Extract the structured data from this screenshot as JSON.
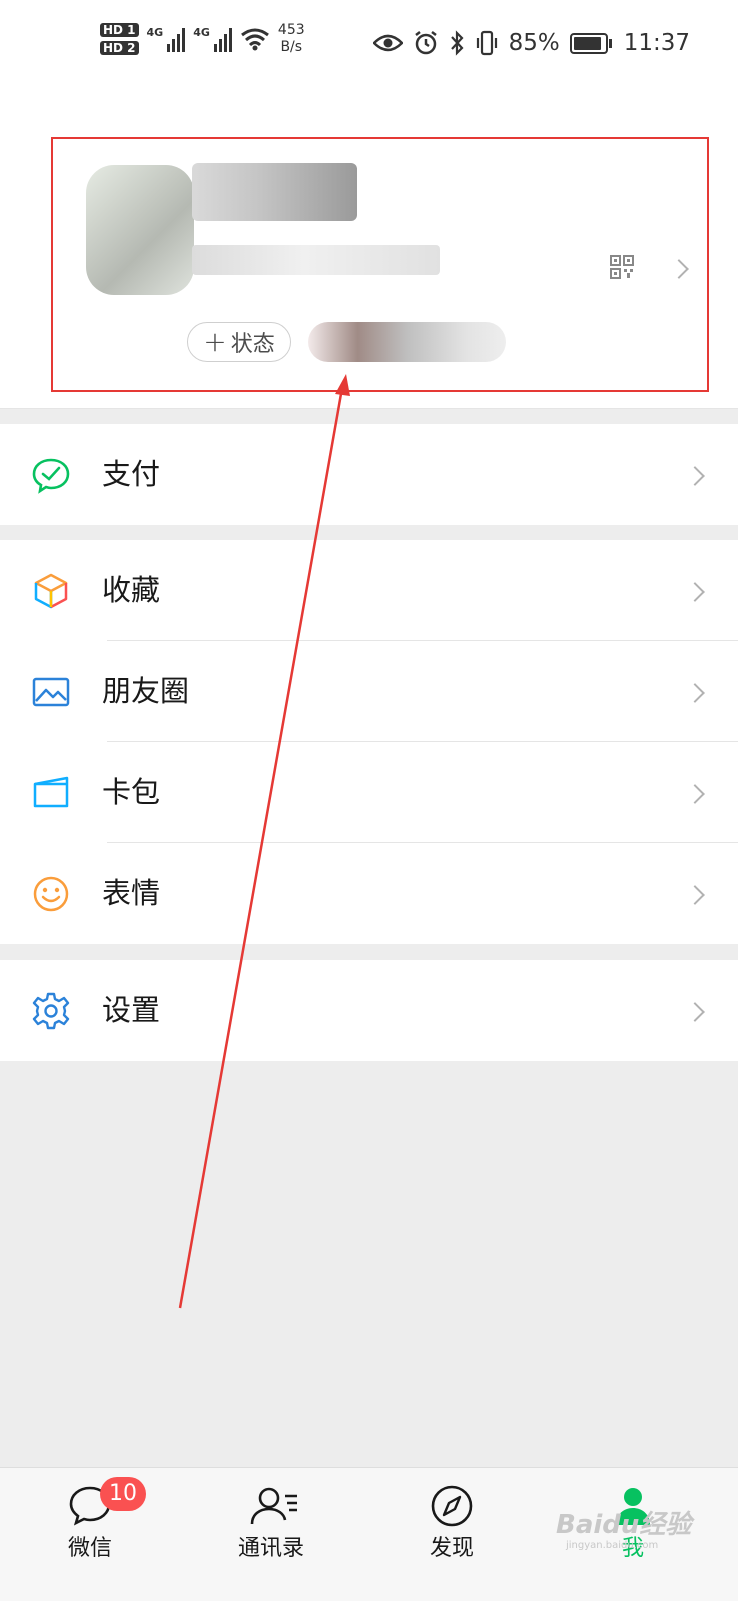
{
  "status_bar": {
    "hd1": "HD 1",
    "hd2": "HD 2",
    "sig1": "4G",
    "sig2": "4G",
    "net_speed_value": "453",
    "net_speed_unit": "B/s",
    "battery_percent": "85%",
    "time": "11:37"
  },
  "profile": {
    "status_button": "状态",
    "status_plus": "+"
  },
  "menu": {
    "pay": "支付",
    "favorites": "收藏",
    "moments": "朋友圈",
    "cards": "卡包",
    "stickers": "表情",
    "settings": "设置"
  },
  "tabbar": {
    "chats": "微信",
    "contacts": "通讯录",
    "discover": "发现",
    "me": "我",
    "chats_badge": "10"
  },
  "watermark": {
    "text": "Baidu经验",
    "sub": "jingyan.baidu.com"
  },
  "colors": {
    "accent_green": "#07c160",
    "badge_red": "#fa5151",
    "annotation_red": "#e53935"
  }
}
